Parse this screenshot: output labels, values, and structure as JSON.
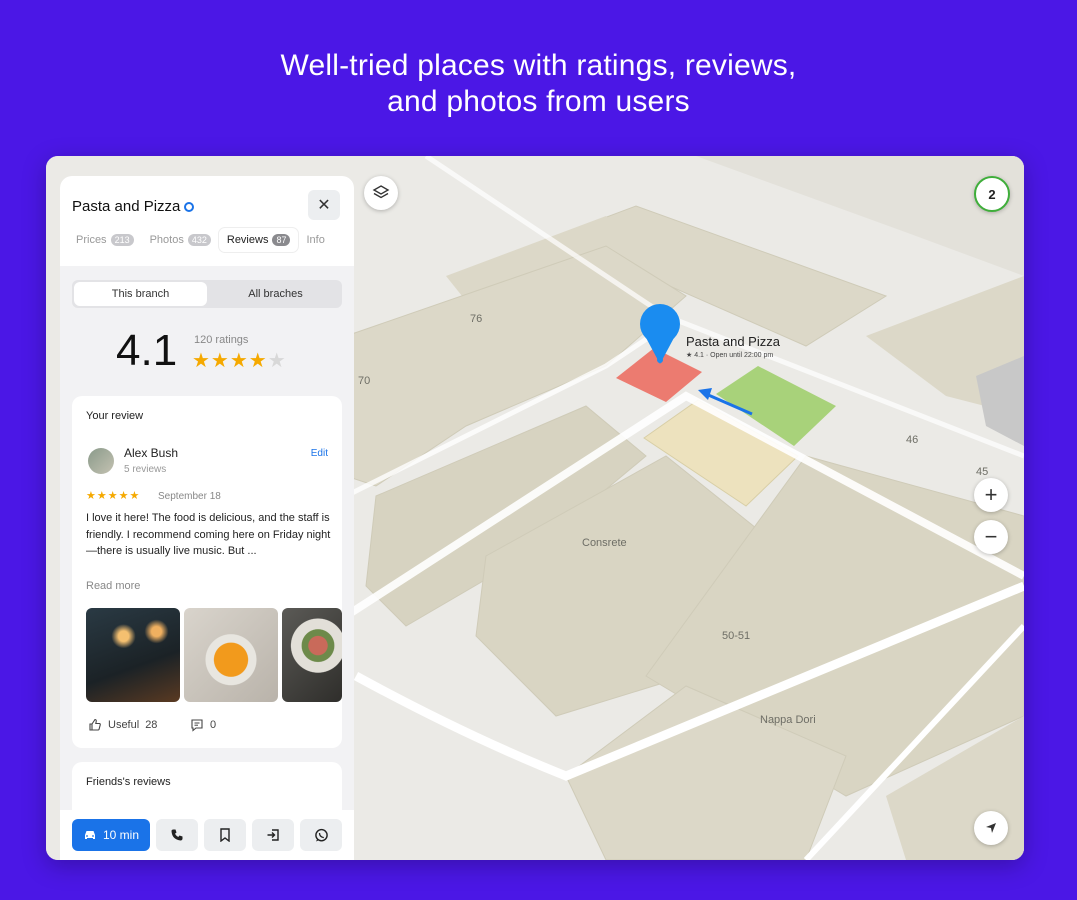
{
  "headline": {
    "line1": "Well-tried places with ratings, reviews,",
    "line2": "and photos from users"
  },
  "map": {
    "badge_count": "2",
    "labels": {
      "n76": "76",
      "n70": "70",
      "n46": "46",
      "n45": "45",
      "concrete": "Consrete",
      "n5051": "50-51",
      "nappa": "Nappa Dori"
    },
    "place": {
      "name": "Pasta and Pizza",
      "subtitle": "★ 4.1 · Open until 22:00 pm"
    },
    "zoom_in": "+",
    "zoom_out": "−",
    "icons": {
      "layers": "layers-icon",
      "locate": "navigation-arrow-icon",
      "pin": "map-pin-icon"
    }
  },
  "panel": {
    "title": "Pasta and Pizza",
    "close": "✕",
    "tabs": [
      {
        "label": "Prices",
        "count": "213"
      },
      {
        "label": "Photos",
        "count": "432"
      },
      {
        "label": "Reviews",
        "count": "87"
      },
      {
        "label": "Info",
        "count": ""
      }
    ],
    "segments": {
      "this_branch": "This branch",
      "all_branches": "All braches"
    },
    "rating": {
      "value": "4.1",
      "count": "120 ratings",
      "stars_filled": "★★★★",
      "stars_empty": "★"
    },
    "review": {
      "section_title": "Your review",
      "author": "Alex Bush",
      "author_reviews": "5 reviews",
      "edit": "Edit",
      "stars": "★★★★★",
      "date": "September 18",
      "text": "I love it here! The food is delicious, and the staff is friendly. I recommend coming here on Friday night—there is usually live music. But ...",
      "read_more": "Read more",
      "useful": "Useful",
      "useful_count": "28",
      "comments_count": "0"
    },
    "friends": {
      "section_title": "Friends's reviews"
    },
    "actions": {
      "route_time": "10 min"
    }
  },
  "colors": {
    "background": "#4b17e6",
    "accent": "#1a73e8",
    "star": "#f5a900",
    "building": "#d9d6c4",
    "highlight_red": "#ec7b70",
    "highlight_green": "#a8d27a"
  }
}
